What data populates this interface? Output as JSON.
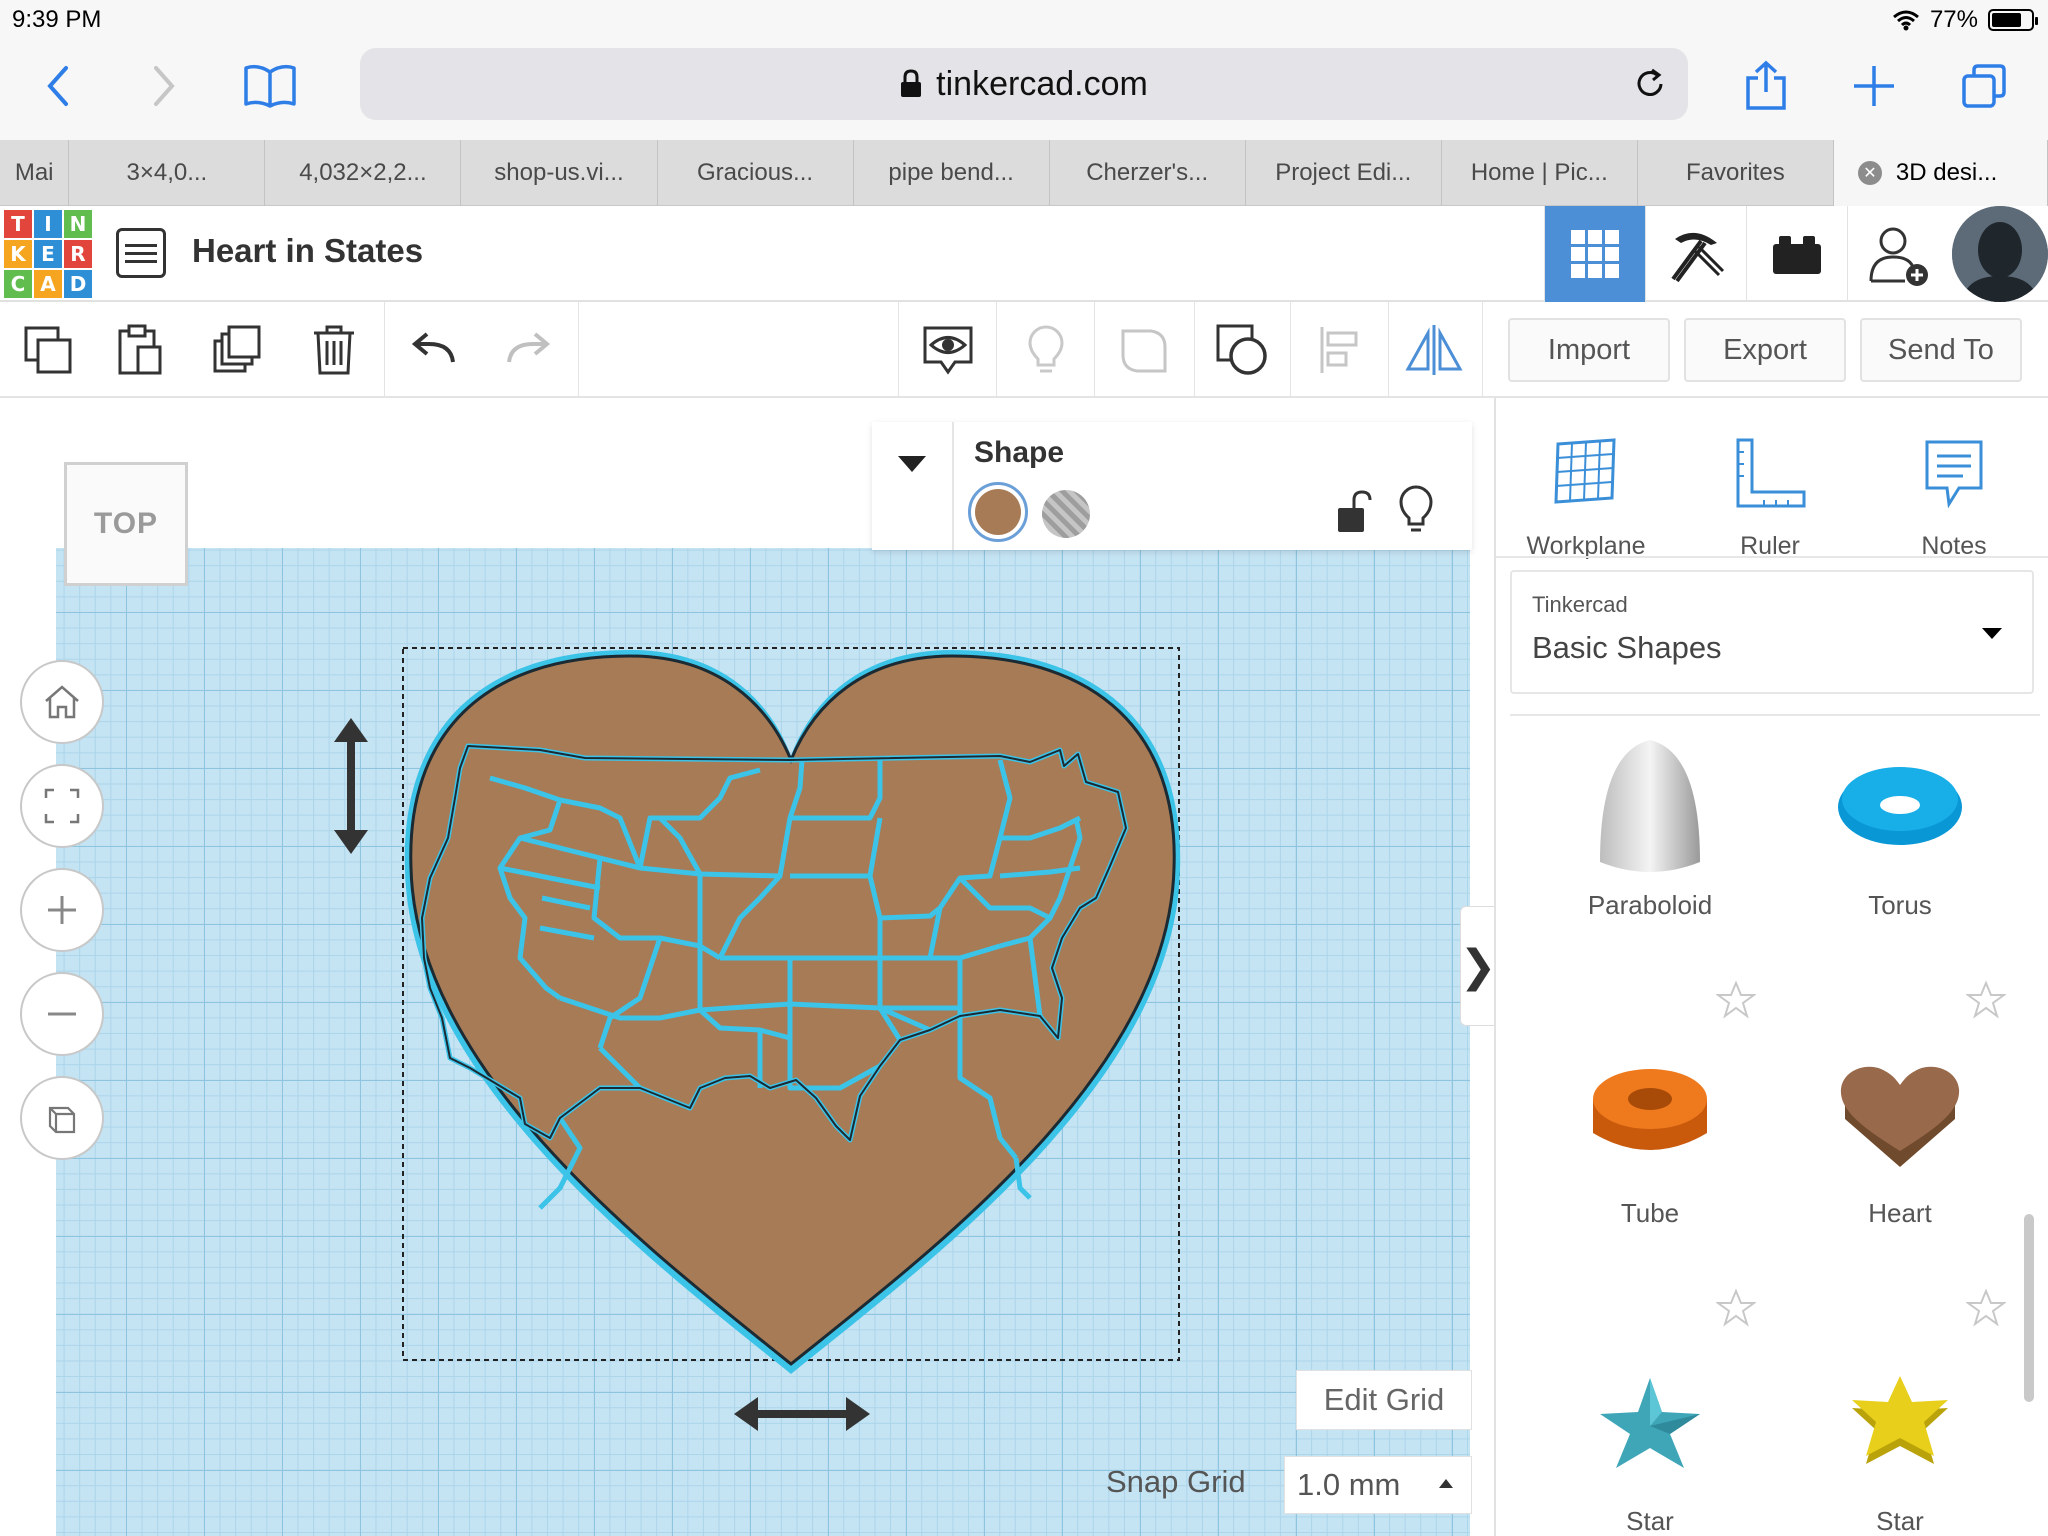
{
  "status_bar": {
    "time": "9:39 PM",
    "battery": "77%",
    "battery_level": 0.77
  },
  "browser": {
    "url": "tinkercad.com",
    "tabs": [
      {
        "label": "Mai"
      },
      {
        "label": "3×4,0..."
      },
      {
        "label": "4,032×2,2..."
      },
      {
        "label": "shop-us.vi..."
      },
      {
        "label": "Gracious..."
      },
      {
        "label": "pipe bend..."
      },
      {
        "label": "Cherzer's..."
      },
      {
        "label": "Project Edi..."
      },
      {
        "label": "Home | Pic..."
      },
      {
        "label": "Favorites"
      },
      {
        "label": "3D desi..."
      }
    ],
    "close_glyph": "✕"
  },
  "app": {
    "logo_letters": [
      "T",
      "I",
      "N",
      "K",
      "E",
      "R",
      "C",
      "A",
      "D"
    ],
    "logo_colors": [
      "#e2453b",
      "#2f8fd6",
      "#62bd4f",
      "#f6a521",
      "#2f8fd6",
      "#e2453b",
      "#62bd4f",
      "#f6a521",
      "#2f8fd6"
    ],
    "design_title": "Heart in States",
    "accent": "#4c8fd6",
    "views": [
      "3d-view-icon",
      "codeblocks-icon",
      "bricks-icon"
    ]
  },
  "toolbar": {
    "import_label": "Import",
    "export_label": "Export",
    "send_to_label": "Send To"
  },
  "workplane": {
    "viewcube_label": "TOP",
    "shape_color": "#a77b55",
    "grid_color": "#c4e3f3"
  },
  "inspector": {
    "title": "Shape",
    "solid_color": "#a77b55"
  },
  "grid_controls": {
    "edit_grid_label": "Edit Grid",
    "snap_grid_label": "Snap Grid",
    "snap_value": "1.0 mm"
  },
  "panel": {
    "tools": [
      {
        "label": "Workplane"
      },
      {
        "label": "Ruler"
      },
      {
        "label": "Notes"
      }
    ],
    "library_provider": "Tinkercad",
    "library_name": "Basic Shapes",
    "shapes": [
      {
        "label": "Paraboloid"
      },
      {
        "label": "Torus"
      },
      {
        "label": "Tube"
      },
      {
        "label": "Heart"
      },
      {
        "label": "Star"
      },
      {
        "label": "Star"
      }
    ]
  },
  "toggle_glyph": "❯"
}
